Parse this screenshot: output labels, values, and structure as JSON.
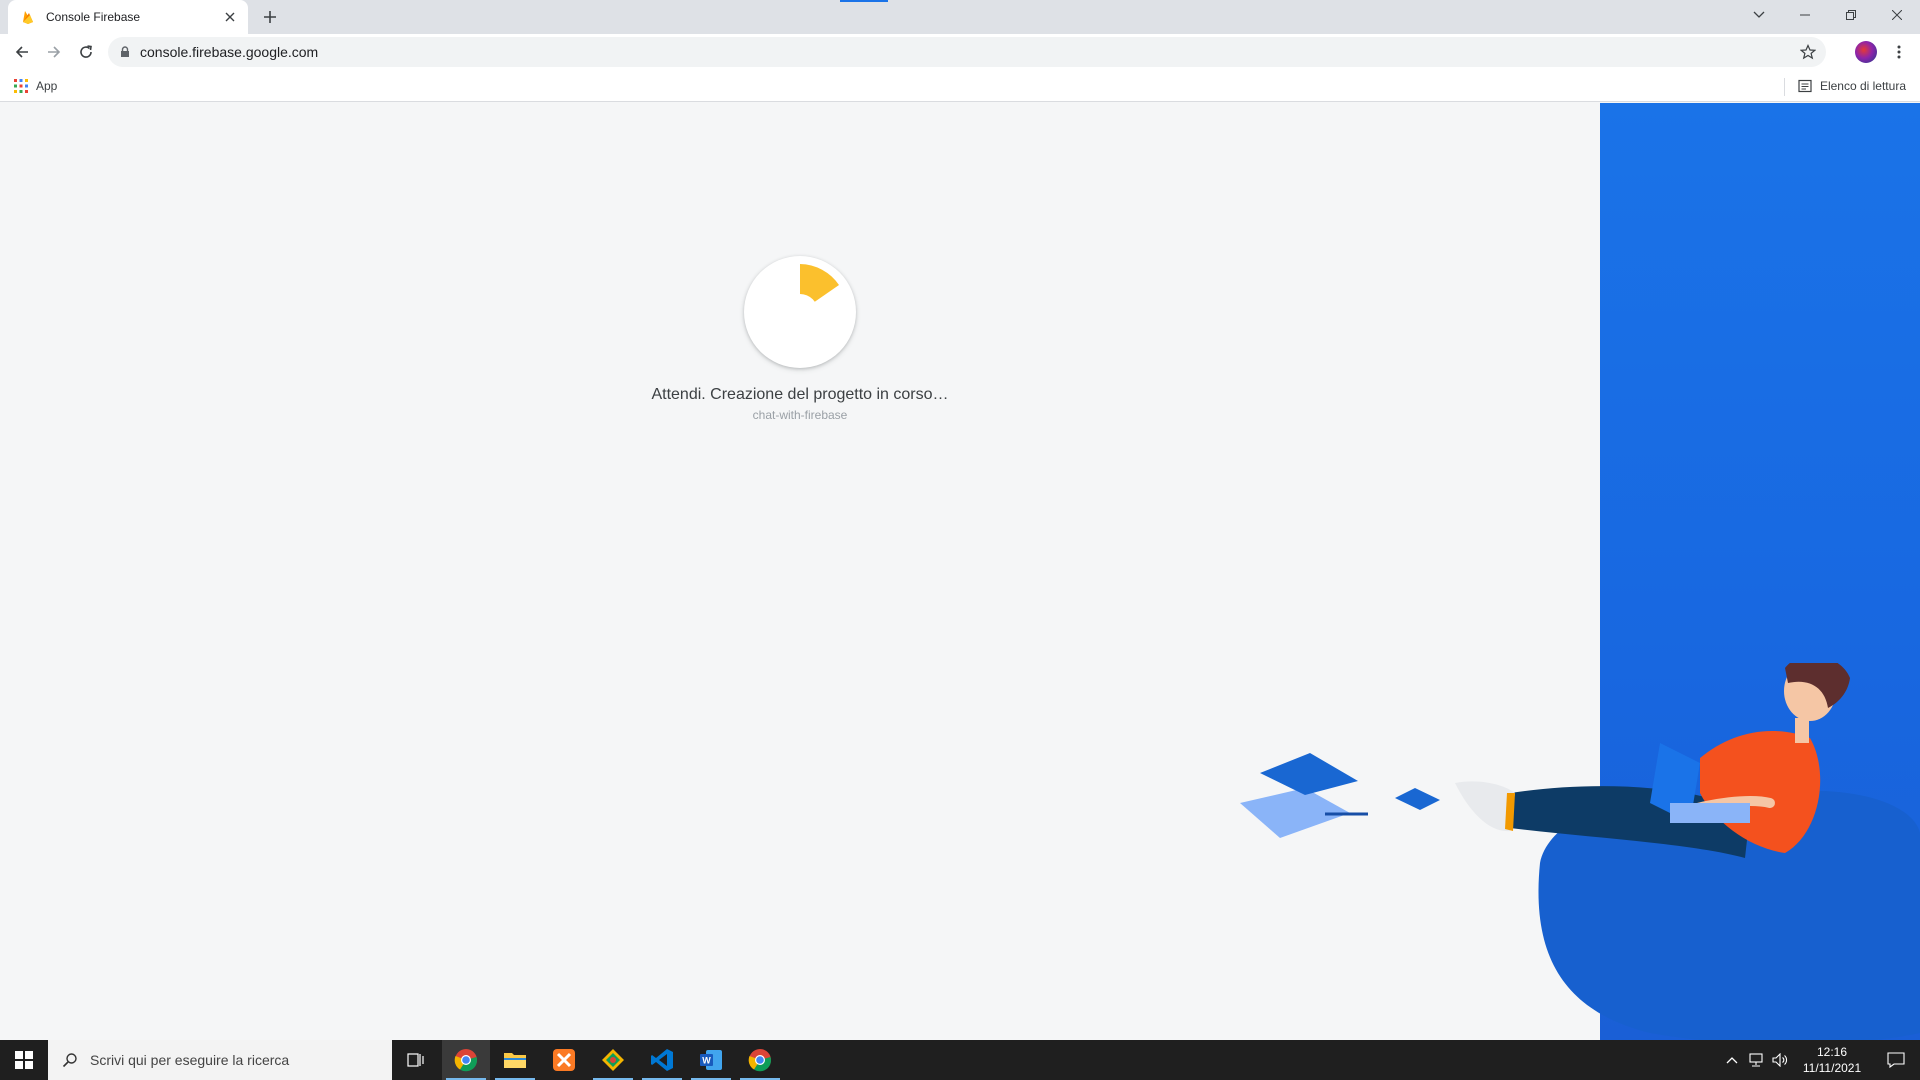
{
  "browser": {
    "tab": {
      "title": "Console Firebase",
      "favicon": "firebase-icon"
    },
    "address": {
      "url": "console.firebase.google.com"
    },
    "bookmarks": {
      "apps_label": "App",
      "reading_list_label": "Elenco di lettura"
    }
  },
  "page": {
    "status_text": "Attendi. Creazione del progetto in corso…",
    "project_name": "chat-with-firebase"
  },
  "taskbar": {
    "search_placeholder": "Scrivi qui per eseguire la ricerca",
    "apps": [
      "task-view",
      "chrome",
      "file-explorer",
      "xampp",
      "git-kraken",
      "vscode",
      "word",
      "chrome"
    ],
    "time": "12:16",
    "date": "11/11/2021"
  },
  "colors": {
    "accent_blue": "#1a73e8",
    "spinner_yellow": "#fbc02d",
    "page_bg": "#f5f6f7"
  }
}
